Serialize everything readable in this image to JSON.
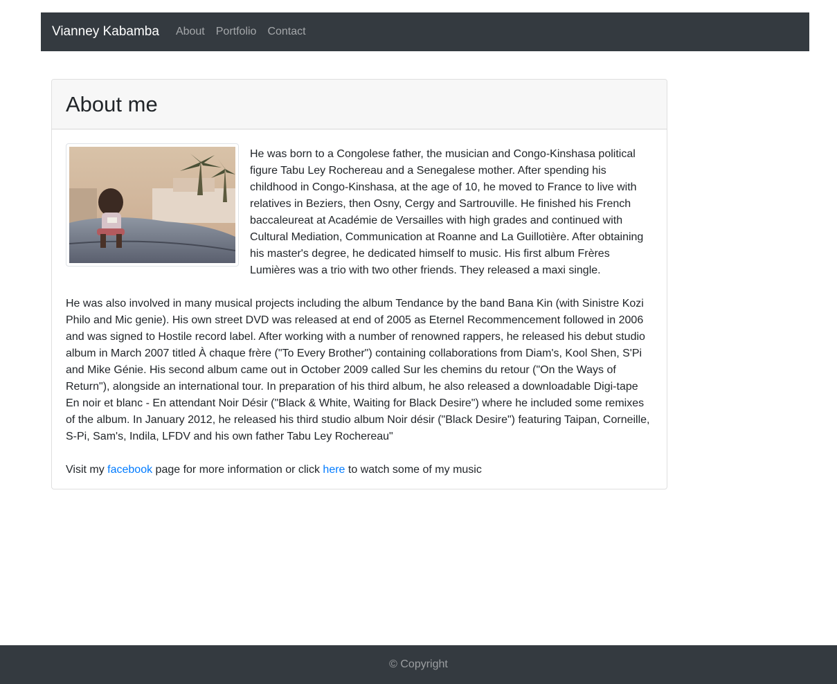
{
  "navbar": {
    "brand": "Vianney Kabamba",
    "links": [
      "About",
      "Portfolio",
      "Contact"
    ]
  },
  "about": {
    "title": "About me",
    "paragraph1": "He was born to a Congolese father, the musician and Congo-Kinshasa political figure Tabu Ley Rochereau and a Senegalese mother. After spending his childhood in Congo-Kinshasa, at the age of 10, he moved to France to live with relatives in Beziers, then Osny, Cergy and Sartrouville. He finished his French baccaleureat at Académie de Versailles with high grades and continued with Cultural Mediation, Communication at Roanne and La Guillotière. After obtaining his master's degree, he dedicated himself to music. His first album Frères Lumières was a trio with two other friends. They released a maxi single.",
    "paragraph2": "He was also involved in many musical projects including the album Tendance by the band Bana Kin (with Sinistre Kozi Philo and Mic genie). His own street DVD was released at end of 2005 as Eternel Recommencement followed in 2006 and was signed to Hostile record label. After working with a number of renowned rappers, he released his debut studio album in March 2007 titled À chaque frère (\"To Every Brother\") containing collaborations from Diam's, Kool Shen, S'Pi and Mike Génie. His second album came out in October 2009 called Sur les chemins du retour (\"On the Ways of Return\"), alongside an international tour. In preparation of his third album, he also released a downloadable Digi-tape En noir et blanc - En attendant Noir Désir (\"Black & White, Waiting for Black Desire\") where he included some remixes of the album. In January 2012, he released his third studio album Noir désir (\"Black Desire\") featuring Taipan, Corneille, S-Pi, Sam's, Indila, LFDV and his own father Tabu Ley Rochereau\"",
    "visit_prefix": "Visit my ",
    "facebook_link": "facebook",
    "visit_middle": " page for more information or click ",
    "here_link": "here",
    "visit_suffix": " to watch some of my music"
  },
  "footer": {
    "copyright": "© Copyright"
  },
  "colors": {
    "navbar_bg": "#343a40",
    "link": "#007bff",
    "card_header_bg": "#f7f7f7"
  }
}
